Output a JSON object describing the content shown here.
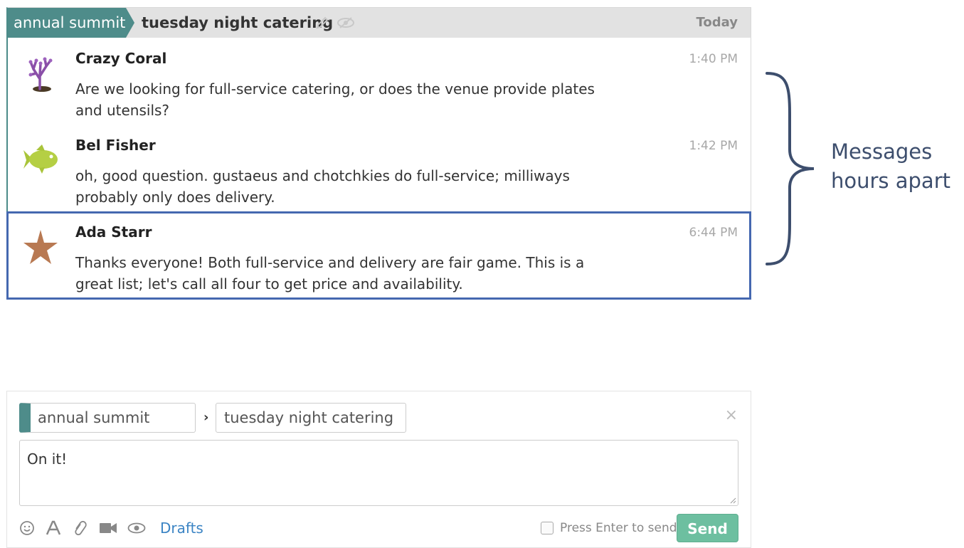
{
  "recipient_bar": {
    "stream": "annual summit",
    "topic": "tuesday night catering",
    "date": "Today"
  },
  "messages": [
    {
      "sender": "Crazy Coral",
      "time": "1:40 PM",
      "body": "Are we looking for full-service catering, or does the venue provide plates and utensils?",
      "avatar_icon": "coral-icon"
    },
    {
      "sender": "Bel Fisher",
      "time": "1:42 PM",
      "body": "oh, good question. gustaeus and chotchkies do full-service; milliways probably only does delivery.",
      "avatar_icon": "fish-icon"
    },
    {
      "sender": "Ada Starr",
      "time": "6:44 PM",
      "body": "Thanks everyone! Both full-service and delivery are fair game. This is a great list; let's call all four to get price and availability.",
      "avatar_icon": "starfish-icon"
    }
  ],
  "annotation": {
    "text": "Messages hours apart"
  },
  "compose": {
    "stream": "annual summit",
    "topic": "tuesday night catering",
    "content": "On it!",
    "drafts_label": "Drafts",
    "enter_to_send_label": "Press Enter to send",
    "enter_to_send_checked": false,
    "send_label": "Send",
    "close_glyph": "×",
    "chevron_glyph": "›",
    "tools": [
      "emoji-icon",
      "formatting-icon",
      "attachment-icon",
      "video-call-icon",
      "preview-icon"
    ]
  },
  "colors": {
    "stream": "#4e8c8a",
    "selected_border": "#4568b0",
    "send_button": "#6dbfa0",
    "annotation_text": "#3d4e6d",
    "link": "#3b84c4"
  }
}
